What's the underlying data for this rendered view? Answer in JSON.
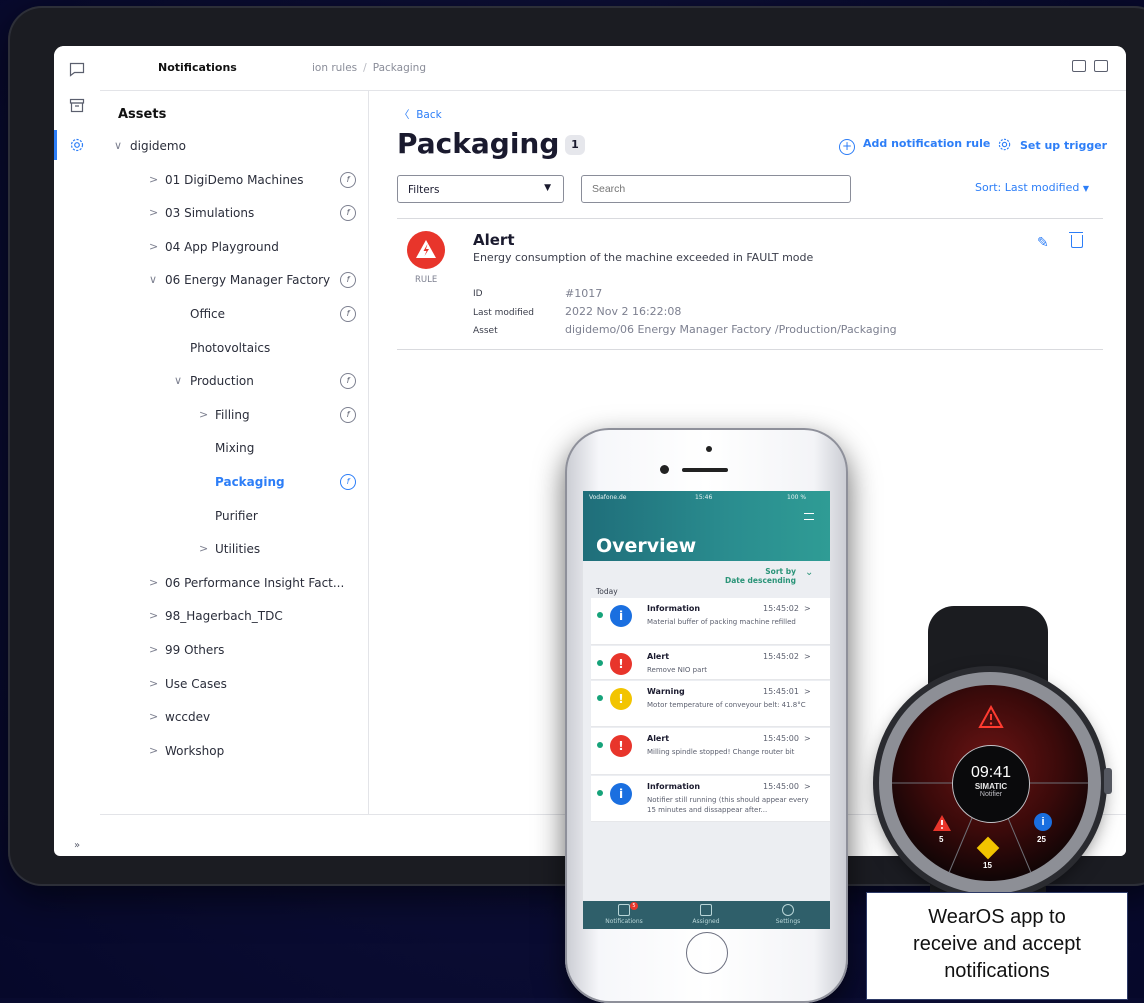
{
  "tablet": {
    "topbar": {
      "title": "Notifications",
      "breadcrumb_1": "ion rules",
      "breadcrumb_sep": "/",
      "breadcrumb_2": "Packaging"
    },
    "rail": {
      "expand_label": "»"
    },
    "tree": {
      "heading": "Assets",
      "items": [
        {
          "label": "digidemo",
          "chev": "∨",
          "fx": false
        },
        {
          "label": "01 DigiDemo Machines",
          "chev": ">",
          "fx": true
        },
        {
          "label": "03 Simulations",
          "chev": ">",
          "fx": true
        },
        {
          "label": "04 App Playground",
          "chev": ">",
          "fx": false
        },
        {
          "label": "06 Energy Manager Factory",
          "chev": "∨",
          "fx": true
        },
        {
          "label": "Office",
          "chev": "",
          "fx": true
        },
        {
          "label": "Photovoltaics",
          "chev": "",
          "fx": false
        },
        {
          "label": "Production",
          "chev": "∨",
          "fx": true
        },
        {
          "label": "Filling",
          "chev": ">",
          "fx": true
        },
        {
          "label": "Mixing",
          "chev": "",
          "fx": false
        },
        {
          "label": "Packaging",
          "chev": "",
          "fx": true,
          "selected": true
        },
        {
          "label": "Purifier",
          "chev": "",
          "fx": false
        },
        {
          "label": "Utilities",
          "chev": ">",
          "fx": false
        },
        {
          "label": "06 Performance Insight Fact...",
          "chev": ">",
          "fx": false
        },
        {
          "label": "98_Hagerbach_TDC",
          "chev": ">",
          "fx": false
        },
        {
          "label": "99 Others",
          "chev": ">",
          "fx": false
        },
        {
          "label": "Use Cases",
          "chev": ">",
          "fx": false
        },
        {
          "label": "wccdev",
          "chev": ">",
          "fx": false
        },
        {
          "label": "Workshop",
          "chev": ">",
          "fx": false
        }
      ]
    },
    "main": {
      "back": "Back",
      "title": "Packaging",
      "count": "1",
      "add_rule": "Add notification rule",
      "set_trigger": "Set up trigger",
      "filters": "Filters",
      "search_placeholder": "Search",
      "sort": "Sort: Last modified",
      "rule": {
        "badge": "RULE",
        "title": "Alert",
        "description": "Energy consumption of the machine exceeded in FAULT mode",
        "id_label": "ID",
        "id_value": "#1017",
        "modified_label": "Last modified",
        "modified_value": "2022 Nov 2 16:22:08",
        "asset_label": "Asset",
        "asset_value": "digidemo/06 Energy Manager Factory /Production/Packaging"
      }
    }
  },
  "phone": {
    "status_carrier": "Vodafone.de",
    "status_time": "15:46",
    "status_battery": "100 %",
    "title": "Overview",
    "sort_by": "Sort by",
    "sort_value": "Date descending",
    "today": "Today",
    "items": [
      {
        "type": "Information",
        "time": "15:45:02",
        "message": "Material buffer of packing machine refilled",
        "color": "#1a6fe0",
        "glyph": "i"
      },
      {
        "type": "Alert",
        "time": "15:45:02",
        "message": "Remove NIO part",
        "color": "#e8352b",
        "glyph": "!"
      },
      {
        "type": "Warning",
        "time": "15:45:01",
        "message": "Motor temperature of conveyour belt: 41.8°C",
        "color": "#f2c400",
        "glyph": "!"
      },
      {
        "type": "Alert",
        "time": "15:45:00",
        "message": "Milling spindle stopped! Change router bit",
        "color": "#e8352b",
        "glyph": "!"
      },
      {
        "type": "Information",
        "time": "15:45:00",
        "message": "Notifier still running (this should appear every 15 minutes and dissappear after...",
        "color": "#1a6fe0",
        "glyph": "i"
      }
    ],
    "tabs": [
      {
        "label": "Notifications",
        "badge": "5"
      },
      {
        "label": "Assigned"
      },
      {
        "label": "Settings"
      }
    ]
  },
  "watch": {
    "time": "09:41",
    "brand": "SIMATIC",
    "app": "Notifier",
    "alerts_count": "5",
    "warnings_count": "15",
    "info_count": "25"
  },
  "caption": {
    "line1": "WearOS app to",
    "line2": "receive and accept",
    "line3": "notifications"
  },
  "colors": {
    "accent": "#2d7ef7",
    "alert": "#e8352b",
    "warning": "#f2c400",
    "info": "#1a6fe0",
    "phone_header": "#2a8d8f"
  }
}
